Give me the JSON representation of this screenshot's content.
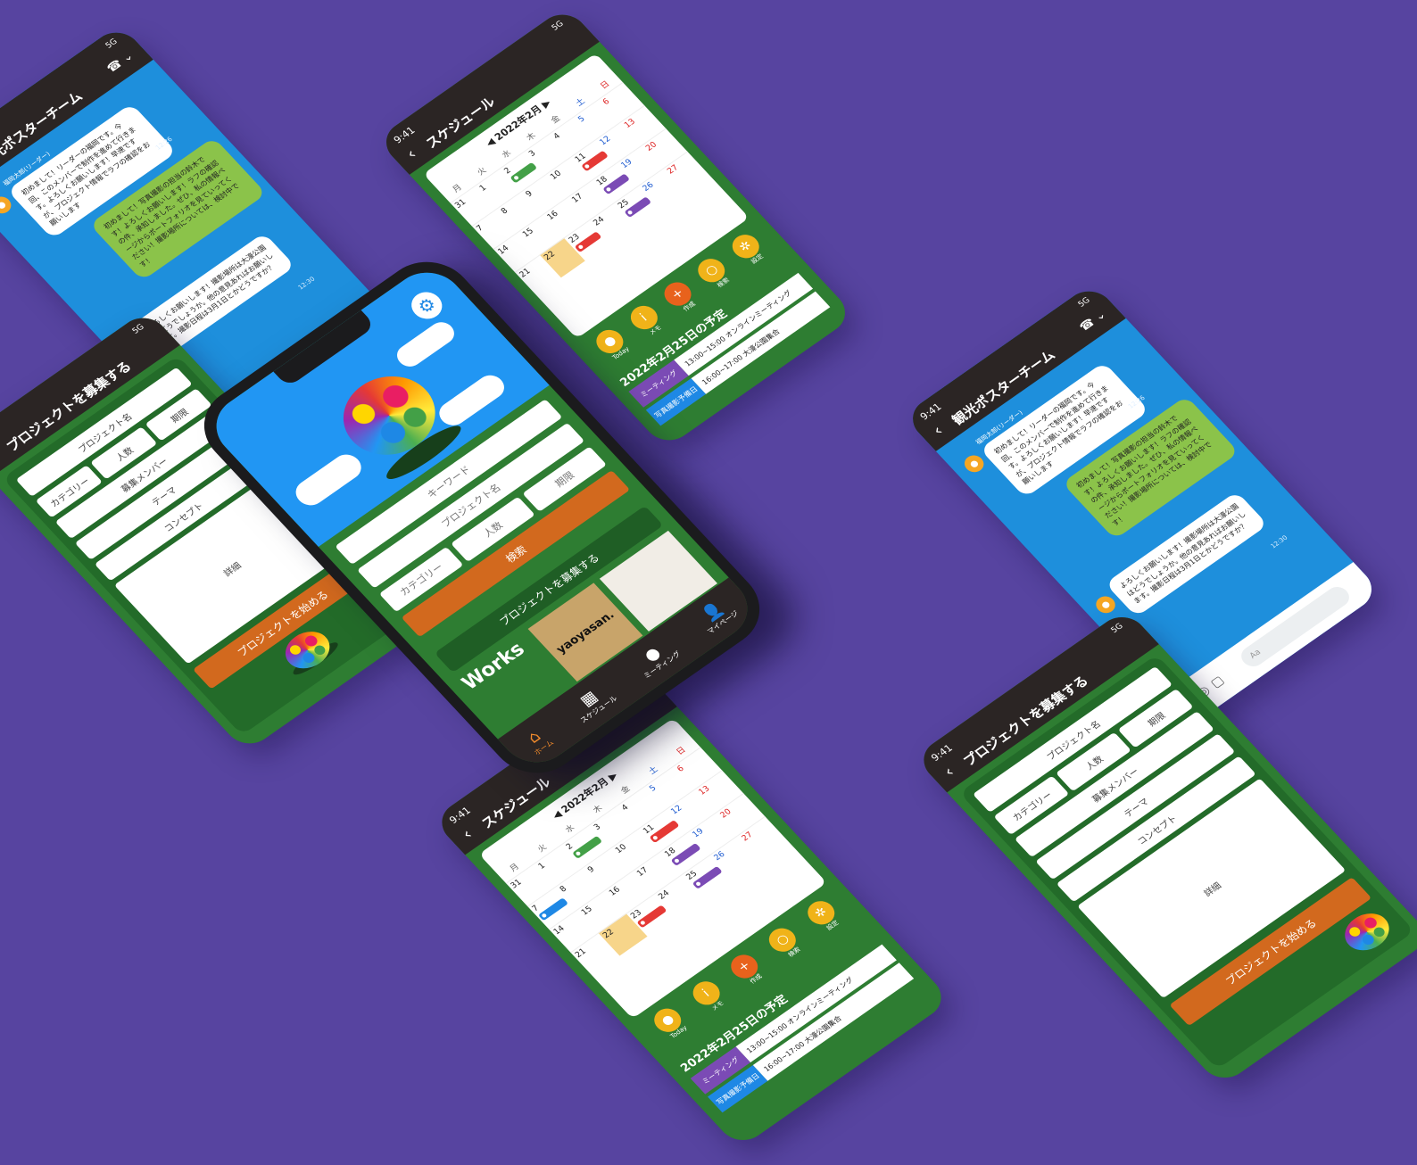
{
  "status": {
    "time": "9:41",
    "signal": "5G"
  },
  "schedule": {
    "title": "スケジュール",
    "month_label": "◀ 2022年2月 ▶",
    "weekdays": [
      "月",
      "火",
      "水",
      "木",
      "金",
      "土",
      "日"
    ],
    "days": [
      "31",
      "1",
      "2",
      "3",
      "4",
      "5",
      "6",
      "7",
      "8",
      "9",
      "10",
      "11",
      "12",
      "13",
      "14",
      "15",
      "16",
      "17",
      "18",
      "19",
      "20",
      "21",
      "22",
      "23",
      "24",
      "25",
      "26",
      "27",
      "28",
      "1",
      "2",
      "3",
      "4",
      "5",
      "6"
    ],
    "tools": [
      "Today",
      "メモ",
      "作成",
      "検索",
      "設定"
    ],
    "day_title": "2022年2月25日の予定",
    "events": [
      {
        "label": "ミーティング",
        "text": "13:00~15:00 オンラインミーティング"
      },
      {
        "label": "写真撮影予備日",
        "text": "16:00~17:00 大濠公園集合"
      }
    ]
  },
  "recruit": {
    "title": "プロジェクトを募集する",
    "fields": {
      "name": "プロジェクト名",
      "category": "カテゴリー",
      "people": "人数",
      "deadline": "期限",
      "members": "募集メンバー",
      "theme": "テーマ",
      "concept": "コンセプト",
      "detail": "詳細"
    },
    "start_button": "プロジェクトを始める"
  },
  "chat": {
    "title": "観光ポスターチーム",
    "sender_leader": "福岡太郎(リーダー)",
    "msg1": "初めまして！リーダーの福岡です。今回、このメンバーで制作を進めて行きます。よろしくお願いします！早速ですが、プロジェクト情報でラフの確認をお願いします",
    "msg2": "初めまして！写真撮影の担当の鈴木です！よろしくお願いします！ラフの確認の件、承知しました。ぜひ、私の情報ページからポートフォリオを見ていってください！撮影場所については、検討中です！",
    "msg3": "よろしくお願いします！撮影場所は大濠公園はどうでしょうか。他の意見あればお願いします。撮影日程は3月1日とかどうですか？",
    "time1": "12:26",
    "time2": "12:30",
    "input_placeholder": "Aa"
  },
  "home": {
    "keyword_placeholder": "キーワード",
    "project_placeholder": "プロジェクト名",
    "category_placeholder": "カテゴリー",
    "people_placeholder": "人数",
    "deadline_placeholder": "期限",
    "search_button": "検索",
    "recruit_button": "プロジェクトを募集する",
    "works_label": "Works",
    "works_card_text": "yaoyasan.",
    "tabs": [
      "ホーム",
      "スケジュール",
      "ミーティング",
      "マイページ"
    ]
  },
  "colors": {
    "background": "#5744a0",
    "green": "#2e7d32",
    "sky": "#1e8fdc",
    "orange_button": "#d2691e",
    "dark_bar": "#2b2524"
  }
}
